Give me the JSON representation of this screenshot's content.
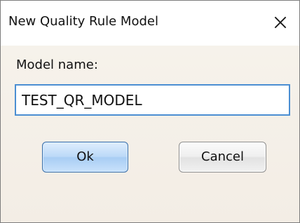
{
  "dialog": {
    "title": "New Quality Rule Model",
    "close_icon": "close-icon"
  },
  "form": {
    "model_name_label": "Model name:",
    "model_name_value": "TEST_QR_MODEL"
  },
  "buttons": {
    "ok_label": "Ok",
    "cancel_label": "Cancel"
  },
  "colors": {
    "dialog_background": "#f6f2eb",
    "input_border": "#4b8ed2",
    "primary_button": "#bcd9f8",
    "secondary_button": "#efefef"
  }
}
